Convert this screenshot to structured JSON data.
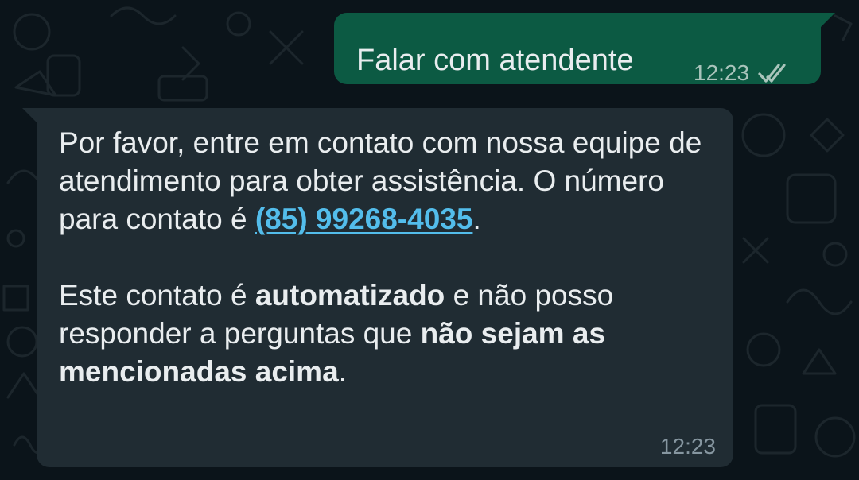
{
  "chat": {
    "messages": [
      {
        "direction": "outgoing",
        "text": "Falar com atendente",
        "time": "12:23",
        "status_icon": "double-check-icon"
      },
      {
        "direction": "incoming",
        "paragraph1": {
          "before_phone": "Por favor, entre em contato com nossa equipe de atendimento para obter assistência. O número para contato é ",
          "phone": "(85) 99268-4035",
          "after_phone": "."
        },
        "paragraph2": {
          "part1": "Este contato é ",
          "bold1": "automatizado",
          "part2": " e não posso responder a perguntas que ",
          "bold2": "não sejam as mencionadas acima",
          "part3": "."
        },
        "time": "12:23"
      }
    ]
  },
  "colors": {
    "background": "#0b141a",
    "outgoing_bubble": "#0c5a43",
    "incoming_bubble": "#202c33",
    "link": "#53bdeb",
    "text": "#e9edef"
  }
}
